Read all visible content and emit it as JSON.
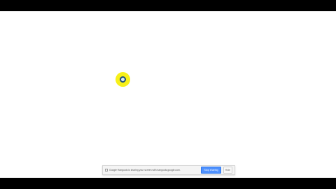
{
  "screen_share_bar": {
    "icon": "checkbox-icon",
    "message": "Google Hangouts is sharing your screen with hangouts.google.com.",
    "stop_label": "Stop sharing",
    "hide_label": "Hide",
    "stop_color": "#4d90fe"
  },
  "cursor": {
    "highlight_color": "#f7f01a"
  }
}
